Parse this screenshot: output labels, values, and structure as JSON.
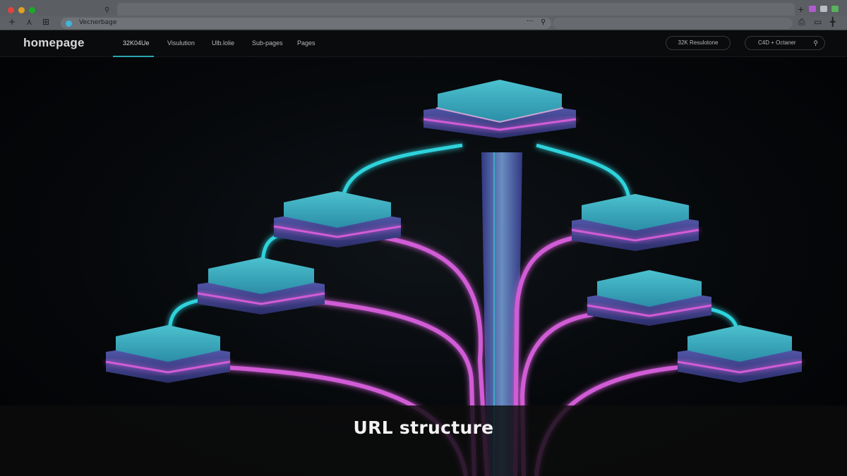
{
  "browser": {
    "tab_search_icon": "search-icon",
    "url": "Vecnerbage",
    "toolbar_icons": [
      "plus-icon",
      "share-icon",
      "sidebar-icon"
    ],
    "right_icons": [
      "sidebar-icon",
      "plus-icon"
    ],
    "url_more": "···"
  },
  "site": {
    "logo": "homepage",
    "nav": [
      {
        "label": "32K04Ue"
      },
      {
        "label": "Visulution"
      },
      {
        "label": "Ulb.lolie"
      },
      {
        "label": "Sub-pages"
      },
      {
        "label": "Pages"
      }
    ],
    "pill_left": "32K Resulotone",
    "pill_right": "C4D + Octaner"
  },
  "hero": {
    "caption": "URL structure",
    "colors": {
      "cyan": "#2fd3dc",
      "magenta": "#d15cd6",
      "node_top": "#3aa8bd",
      "node_side": "#4a4fa0"
    }
  }
}
